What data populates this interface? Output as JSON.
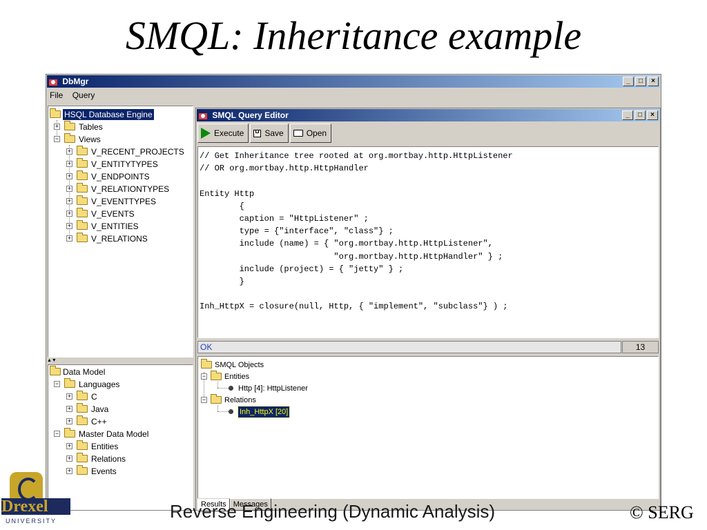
{
  "slide": {
    "title": "SMQL: Inheritance example",
    "footer": "Reverse Engineering (Dynamic Analysis)",
    "footer_right": "© SERG",
    "logo_word": "Drexel",
    "logo_sub": "UNIVERSITY"
  },
  "window": {
    "title": "DbMgr",
    "menu": [
      "File",
      "Query"
    ],
    "buttons": {
      "minimize": "_",
      "maximize": "□",
      "close": "×"
    }
  },
  "db_tree": {
    "root": "HSQL Database Engine",
    "tables": "Tables",
    "views": "Views",
    "view_items": [
      "V_RECENT_PROJECTS",
      "V_ENTITYTYPES",
      "V_ENDPOINTS",
      "V_RELATIONTYPES",
      "V_EVENTTYPES",
      "V_EVENTS",
      "V_ENTITIES",
      "V_RELATIONS"
    ]
  },
  "model_tree": {
    "root": "Data Model",
    "languages": "Languages",
    "language_items": [
      "C",
      "Java",
      "C++"
    ],
    "master": "Master Data Model",
    "master_items": [
      "Entities",
      "Relations",
      "Events"
    ]
  },
  "editor": {
    "title": "SMQL Query Editor",
    "buttons": {
      "execute": "Execute",
      "save": "Save",
      "open": "Open"
    },
    "code": "// Get Inheritance tree rooted at org.mortbay.http.HttpListener\n// OR org.mortbay.http.HttpHandler\n\nEntity Http\n        {\n        caption = \"HttpListener\" ;\n        type = {\"interface\", \"class\"} ;\n        include (name) = { \"org.mortbay.http.HttpListener\",\n                           \"org.mortbay.http.HttpHandler\" } ;\n        include (project) = { \"jetty\" } ;\n        }\n\nInh_HttpX = closure(null, Http, { \"implement\", \"subclass\"} ) ;",
    "status": "OK",
    "line": "13"
  },
  "results": {
    "root": "SMQL Objects",
    "entities": "Entities",
    "entity_item": "Http [4]: HttpListener",
    "relations": "Relations",
    "relation_item": "Inh_HttpX [20]",
    "tabs": [
      "Results",
      "Messages"
    ]
  }
}
